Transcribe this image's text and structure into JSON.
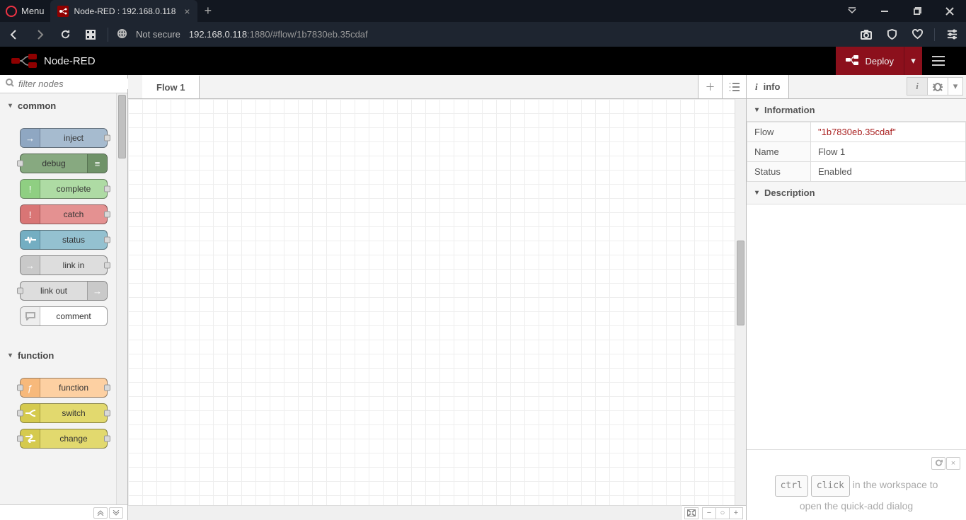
{
  "browser": {
    "menu_label": "Menu",
    "tab_title": "Node-RED : 192.168.0.118",
    "not_secure": "Not secure",
    "url_host": "192.168.0.118",
    "url_port": ":1880",
    "url_path": "/#flow/1b7830eb.35cdaf"
  },
  "header": {
    "app_name": "Node-RED",
    "deploy_label": "Deploy"
  },
  "palette": {
    "filter_placeholder": "filter nodes",
    "categories": {
      "common": {
        "label": "common",
        "nodes": {
          "inject": {
            "label": "inject",
            "bg": "#a6bbcf",
            "icon": "→"
          },
          "debug": {
            "label": "debug",
            "bg": "#87a980",
            "icon": "≡"
          },
          "complete": {
            "label": "complete",
            "bg": "#a9d7a0",
            "icon": "!"
          },
          "catch": {
            "label": "catch",
            "bg": "#e49191",
            "icon": "!"
          },
          "status": {
            "label": "status",
            "bg": "#94c1d0",
            "icon": "⋀⋁"
          },
          "linkin": {
            "label": "link in",
            "bg": "#dddddd",
            "icon": "→"
          },
          "linkout": {
            "label": "link out",
            "bg": "#dddddd",
            "icon": "→"
          },
          "comment": {
            "label": "comment",
            "bg": "#ffffff",
            "icon": "💬"
          }
        }
      },
      "function": {
        "label": "function",
        "nodes": {
          "function": {
            "label": "function",
            "bg": "#fdd0a2",
            "icon": "ƒ"
          },
          "switch": {
            "label": "switch",
            "bg": "#e2d96e",
            "icon": "⤙"
          },
          "change": {
            "label": "change",
            "bg": "#e2d96e",
            "icon": "⇄"
          }
        }
      }
    }
  },
  "workspace": {
    "tab_label": "Flow 1"
  },
  "sidebar": {
    "tab_label": "info",
    "sections": {
      "information": "Information",
      "description": "Description"
    },
    "info": {
      "flow_k": "Flow",
      "flow_v": "\"1b7830eb.35cdaf\"",
      "name_k": "Name",
      "name_v": "Flow 1",
      "status_k": "Status",
      "status_v": "Enabled"
    },
    "tip": {
      "k1": "ctrl",
      "k2": "click",
      "rest1": " in the workspace to",
      "rest2": "open the quick-add dialog"
    }
  }
}
